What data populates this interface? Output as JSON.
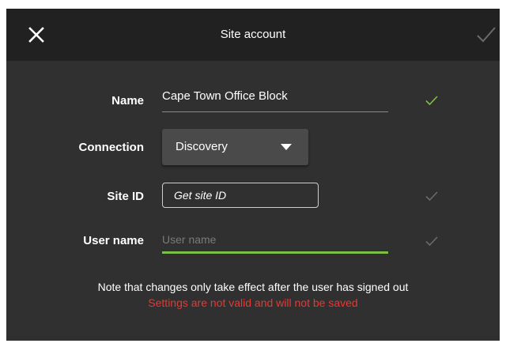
{
  "header": {
    "title": "Site account",
    "close_icon": "close-icon",
    "confirm_icon": "checkmark-icon"
  },
  "form": {
    "name": {
      "label": "Name",
      "value": "Cape Town Office Block",
      "valid": true
    },
    "connection": {
      "label": "Connection",
      "selected": "Discovery"
    },
    "site_id": {
      "label": "Site ID",
      "placeholder": "Get site ID",
      "value": "",
      "valid": false
    },
    "user_name": {
      "label": "User name",
      "placeholder": "User name",
      "value": "",
      "valid": false
    }
  },
  "messages": {
    "note": "Note that changes only take effect after the user has signed out",
    "error": "Settings are not valid and will not be saved"
  },
  "colors": {
    "background": "#303030",
    "header": "#212121",
    "accent_green": "#7cc043",
    "error_red": "#e53935",
    "inactive_check": "#6a6a6a"
  }
}
